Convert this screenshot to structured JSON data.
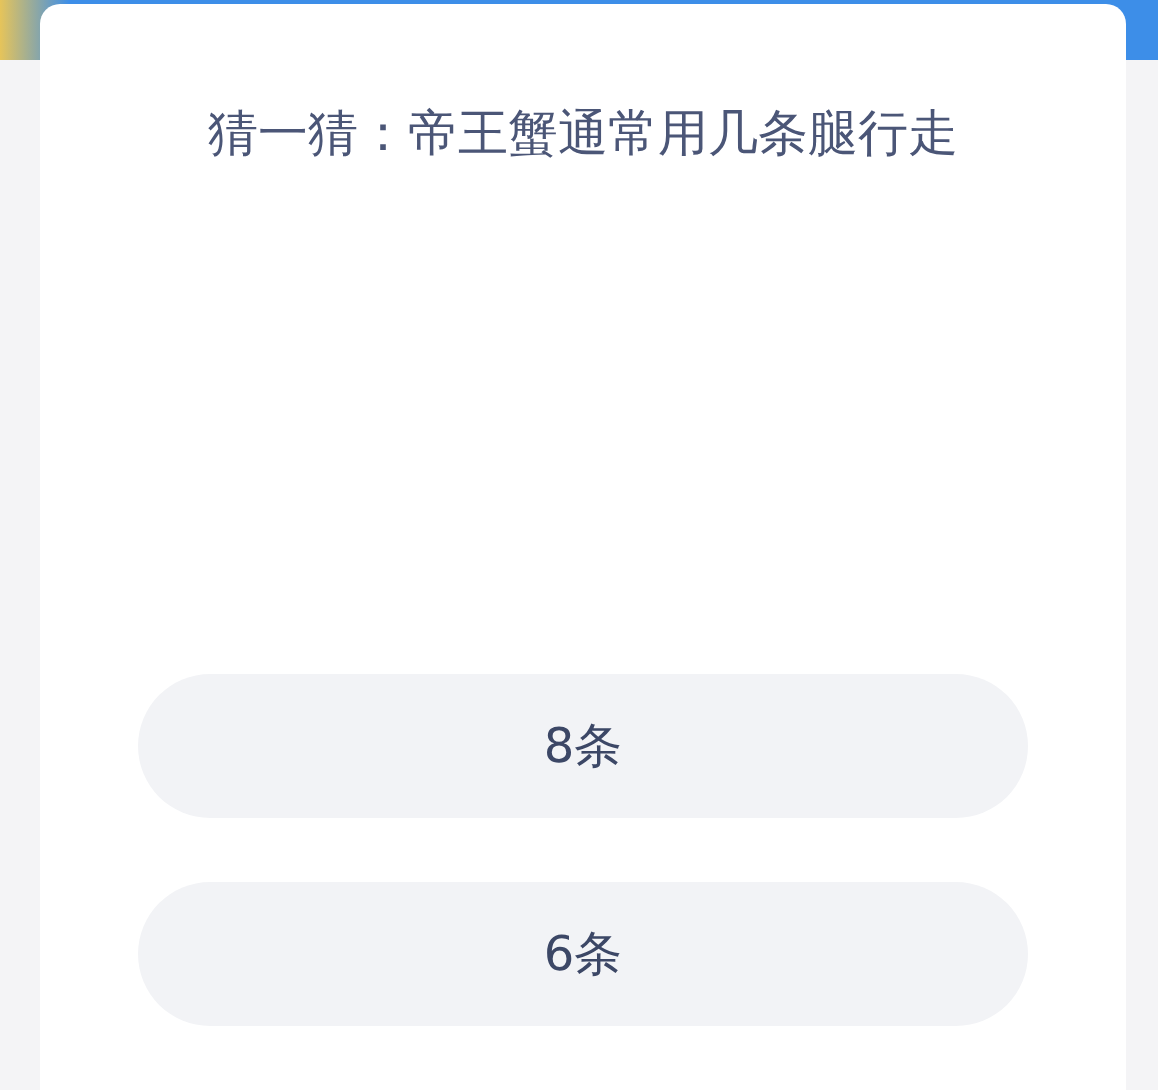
{
  "question": {
    "title": "猜一猜：帝王蟹通常用几条腿行走"
  },
  "options": [
    {
      "label": "8条"
    },
    {
      "label": "6条"
    }
  ]
}
